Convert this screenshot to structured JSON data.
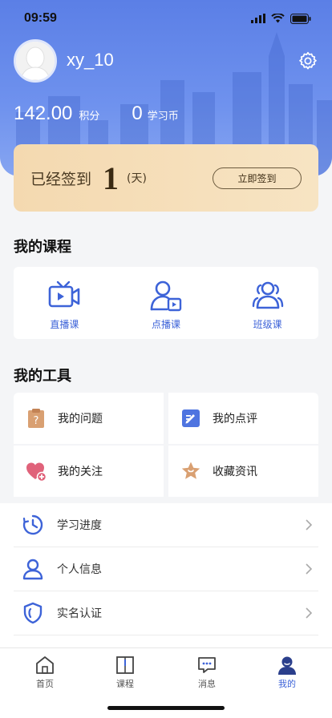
{
  "status_bar": {
    "time": "09:59"
  },
  "profile": {
    "username": "xy_10",
    "points_value": "142.00",
    "points_label": "积分",
    "coins_value": "0",
    "coins_label": "学习币"
  },
  "signin": {
    "text": "已经签到",
    "days": "1",
    "unit": "(天)",
    "button_label": "立即签到"
  },
  "courses": {
    "title": "我的课程",
    "items": [
      {
        "label": "直播课",
        "icon": "live-video-icon"
      },
      {
        "label": "点播课",
        "icon": "on-demand-user-icon"
      },
      {
        "label": "班级课",
        "icon": "class-group-icon"
      }
    ]
  },
  "tools": {
    "title": "我的工具",
    "items": [
      {
        "label": "我的问题",
        "icon": "question-clipboard-icon"
      },
      {
        "label": "我的点评",
        "icon": "review-edit-icon"
      },
      {
        "label": "我的关注",
        "icon": "heart-add-icon"
      },
      {
        "label": "收藏资讯",
        "icon": "star-favorite-icon"
      }
    ]
  },
  "menu": {
    "items": [
      {
        "label": "学习进度",
        "icon": "clock-progress-icon"
      },
      {
        "label": "个人信息",
        "icon": "person-icon"
      },
      {
        "label": "实名认证",
        "icon": "shield-icon"
      }
    ]
  },
  "tab_bar": {
    "items": [
      {
        "label": "首页",
        "icon": "home-icon"
      },
      {
        "label": "课程",
        "icon": "book-icon"
      },
      {
        "label": "消息",
        "icon": "message-icon"
      },
      {
        "label": "我的",
        "icon": "profile-icon",
        "active": true
      }
    ]
  },
  "colors": {
    "header_blue": "#5b7fe6",
    "accent_blue": "#3d63d8",
    "signin_gold": "#f4d9b0"
  }
}
